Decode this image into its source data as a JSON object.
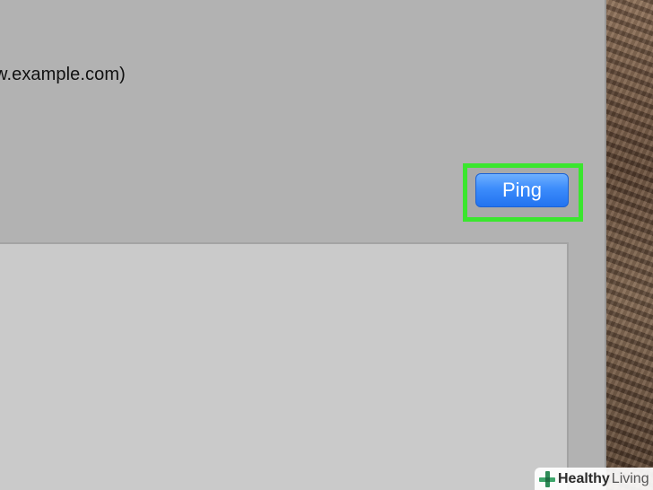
{
  "window": {
    "host_text": "w.example.com)",
    "ping_button": "Ping"
  },
  "colors": {
    "highlight": "#3ae62e",
    "button_blue": "#2273f0",
    "window_bg": "#b2b2b2",
    "output_bg": "#cacaca"
  },
  "watermark": {
    "strong": "Healthy",
    "light": "Living",
    "icon": "plus-cross-icon"
  }
}
